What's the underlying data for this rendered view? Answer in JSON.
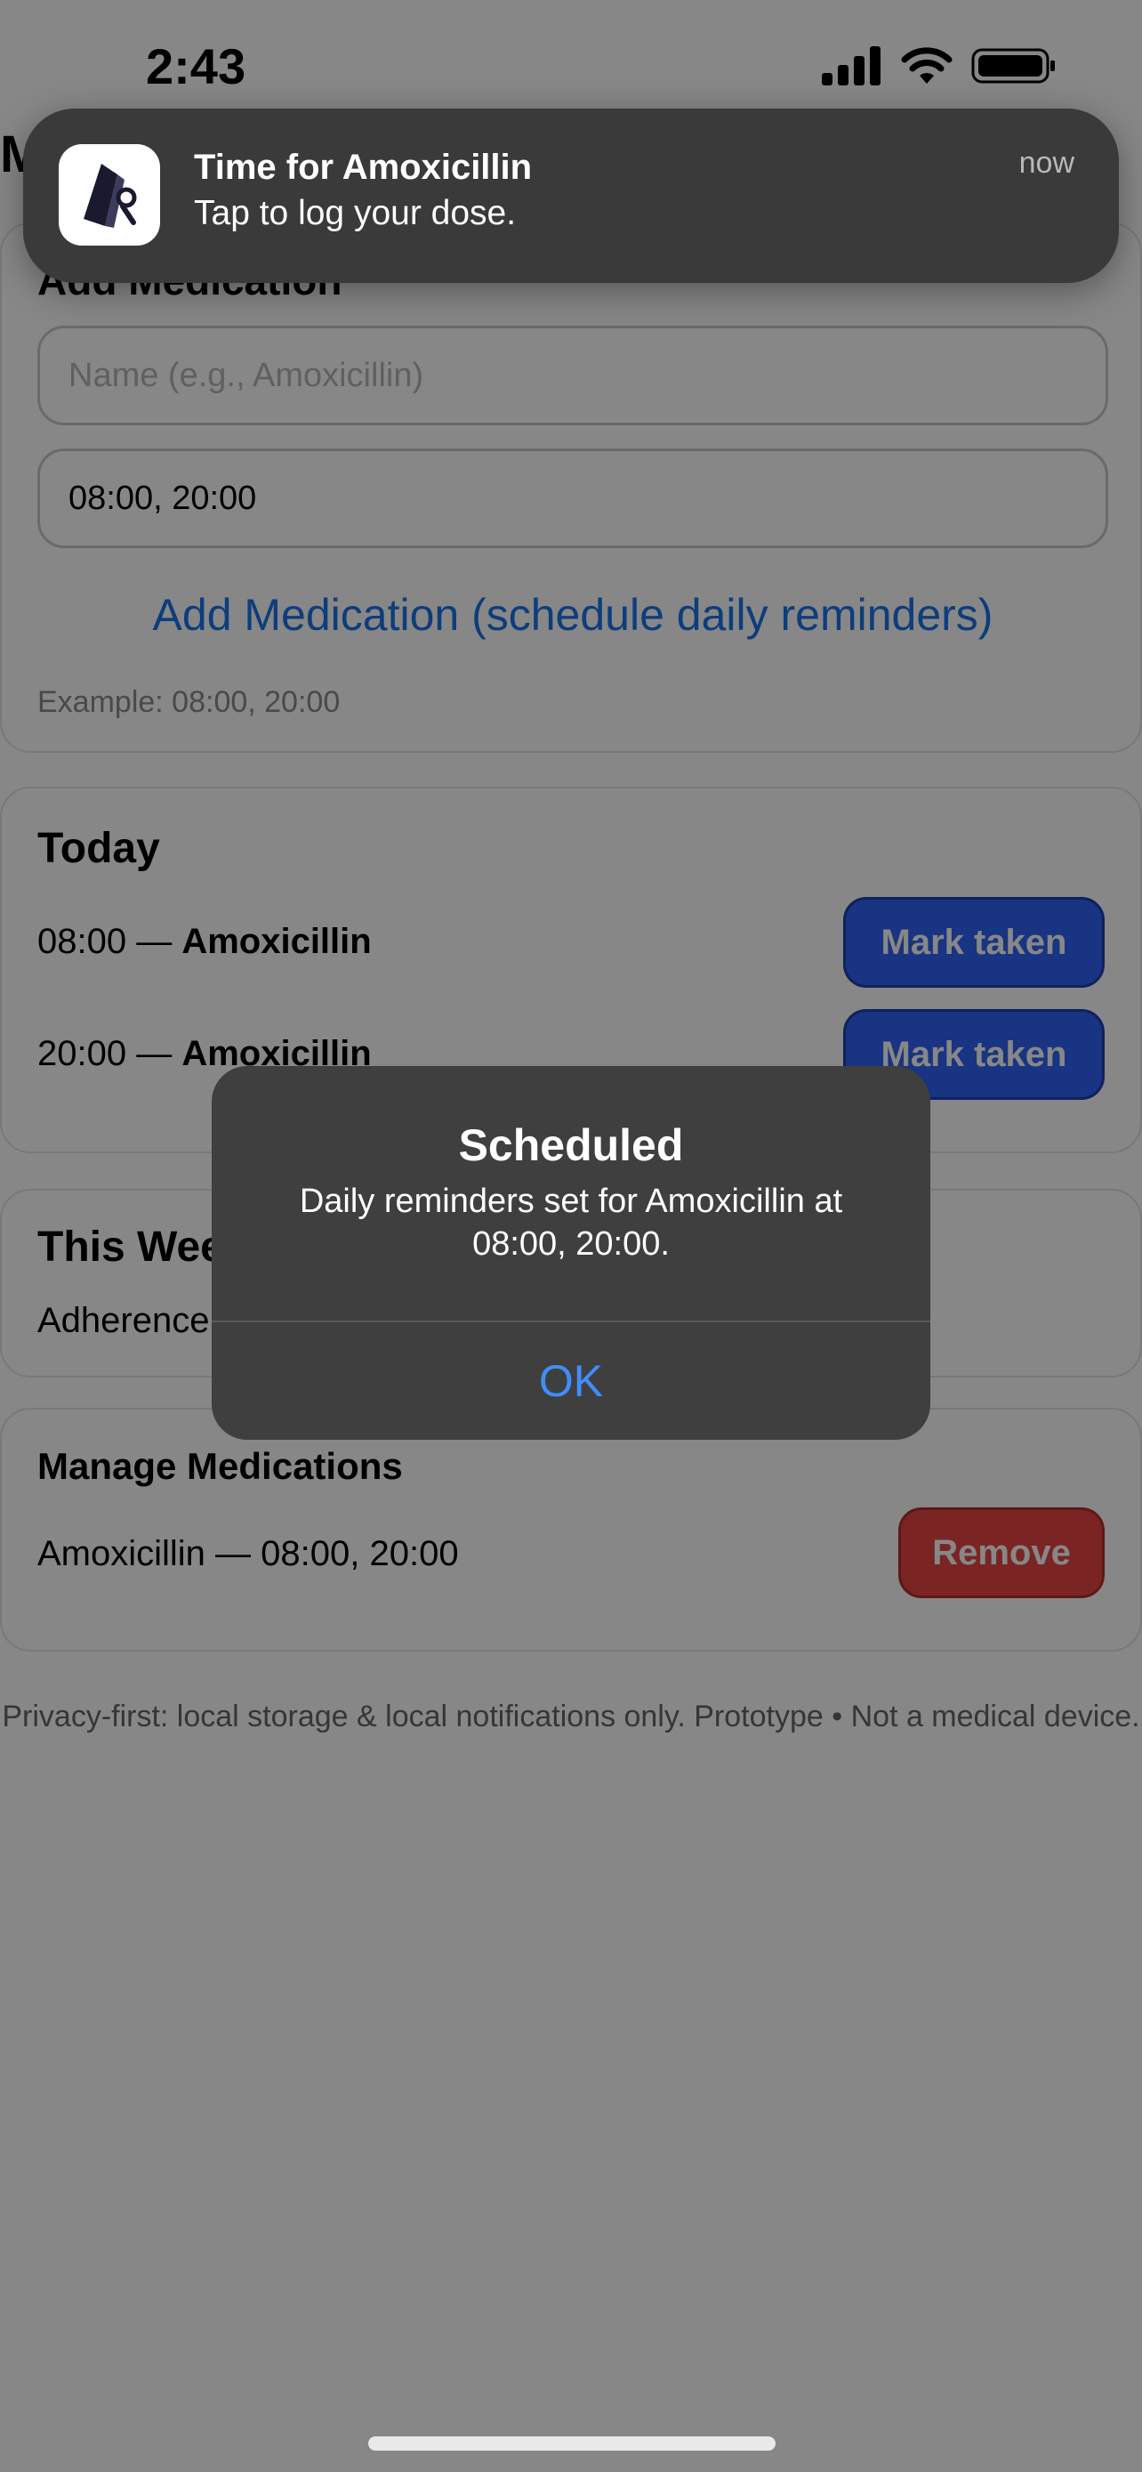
{
  "status_bar": {
    "time": "2:43"
  },
  "app": {
    "page_title": "M",
    "add_medication": {
      "title": "Add Medication",
      "name_placeholder": "Name (e.g., Amoxicillin)",
      "times_value": "08:00, 20:00",
      "add_button_label": "Add Medication (schedule daily reminders)",
      "example_hint": "Example: 08:00, 20:00"
    },
    "today": {
      "title": "Today",
      "doses": [
        {
          "time": "08:00 — ",
          "med": "Amoxicillin",
          "button": "Mark taken"
        },
        {
          "time": "20:00 — ",
          "med": "Amoxicillin",
          "button": "Mark taken"
        }
      ]
    },
    "this_week": {
      "title": "This Week",
      "adherence_label": "Adherence"
    },
    "manage": {
      "title": "Manage Medications",
      "items": [
        {
          "label": "Amoxicillin — 08:00, 20:00",
          "button": "Remove"
        }
      ]
    },
    "footer": "Privacy-first: local storage & local notifications only. Prototype • Not a medical device."
  },
  "notification": {
    "title": "Time for Amoxicillin",
    "body": "Tap to log your dose.",
    "time": "now",
    "icon": "app-logo-icon"
  },
  "alert": {
    "title": "Scheduled",
    "message": "Daily reminders set for Amoxicillin  at 08:00, 20:00.",
    "ok_label": "OK"
  },
  "colors": {
    "primary_blue": "#2f63f5",
    "danger_red": "#e84545",
    "link_blue": "#1a73e8",
    "alert_ok_blue": "#3f8efc"
  }
}
